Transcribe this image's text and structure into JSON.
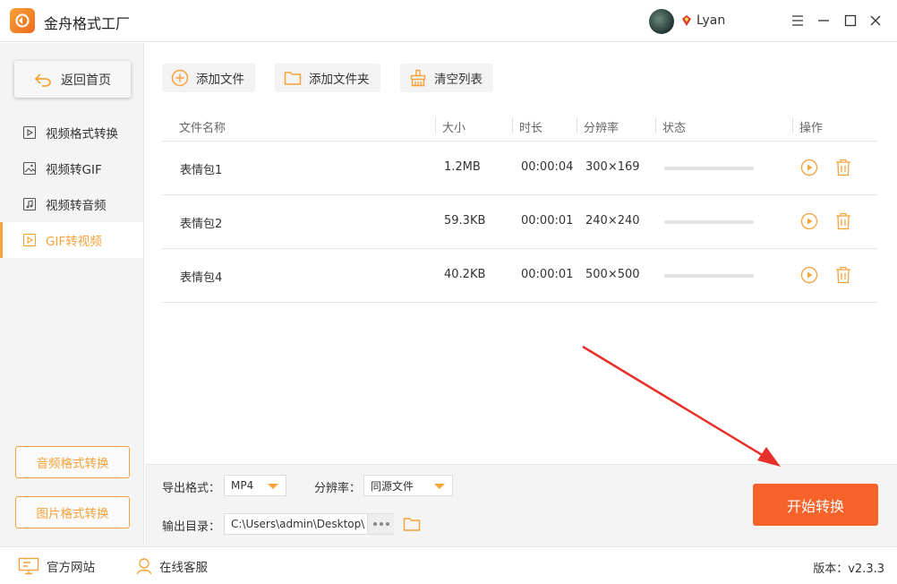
{
  "app": {
    "title": "金舟格式工厂",
    "username": "Lyan"
  },
  "sidebar": {
    "back_label": "返回首页",
    "items": [
      {
        "label": "视频格式转换",
        "icon": "video-file-icon",
        "active": false
      },
      {
        "label": "视频转GIF",
        "icon": "image-file-icon",
        "active": false
      },
      {
        "label": "视频转音频",
        "icon": "audio-file-icon",
        "active": false
      },
      {
        "label": "GIF转视频",
        "icon": "video-file-icon",
        "active": true
      }
    ],
    "bottom_buttons": [
      "音频格式转换",
      "图片格式转换"
    ]
  },
  "toolbar": {
    "add_file": "添加文件",
    "add_folder": "添加文件夹",
    "clear_list": "清空列表"
  },
  "table": {
    "headers": {
      "name": "文件名称",
      "size": "大小",
      "duration": "时长",
      "resolution": "分辨率",
      "status": "状态",
      "actions": "操作"
    },
    "rows": [
      {
        "name": "表情包1",
        "size": "1.2MB",
        "duration": "00:00:04",
        "resolution": "300×169",
        "progress": 0
      },
      {
        "name": "表情包2",
        "size": "59.3KB",
        "duration": "00:00:01",
        "resolution": "240×240",
        "progress": 0
      },
      {
        "name": "表情包4",
        "size": "40.2KB",
        "duration": "00:00:01",
        "resolution": "500×500",
        "progress": 0
      }
    ]
  },
  "settings": {
    "format_label": "导出格式：",
    "format_value": "MP4",
    "resolution_label": "分辨率：",
    "resolution_value": "同源文件",
    "output_label": "输出目录：",
    "output_path": "C:\\Users\\admin\\Desktop\\"
  },
  "start_button": "开始转换",
  "statusbar": {
    "website": "官方网站",
    "support": "在线客服",
    "version": "版本：v2.3.3"
  },
  "colors": {
    "accent": "#f7a23a",
    "primary_button": "#f5632a",
    "arrow": "#e8302a"
  }
}
